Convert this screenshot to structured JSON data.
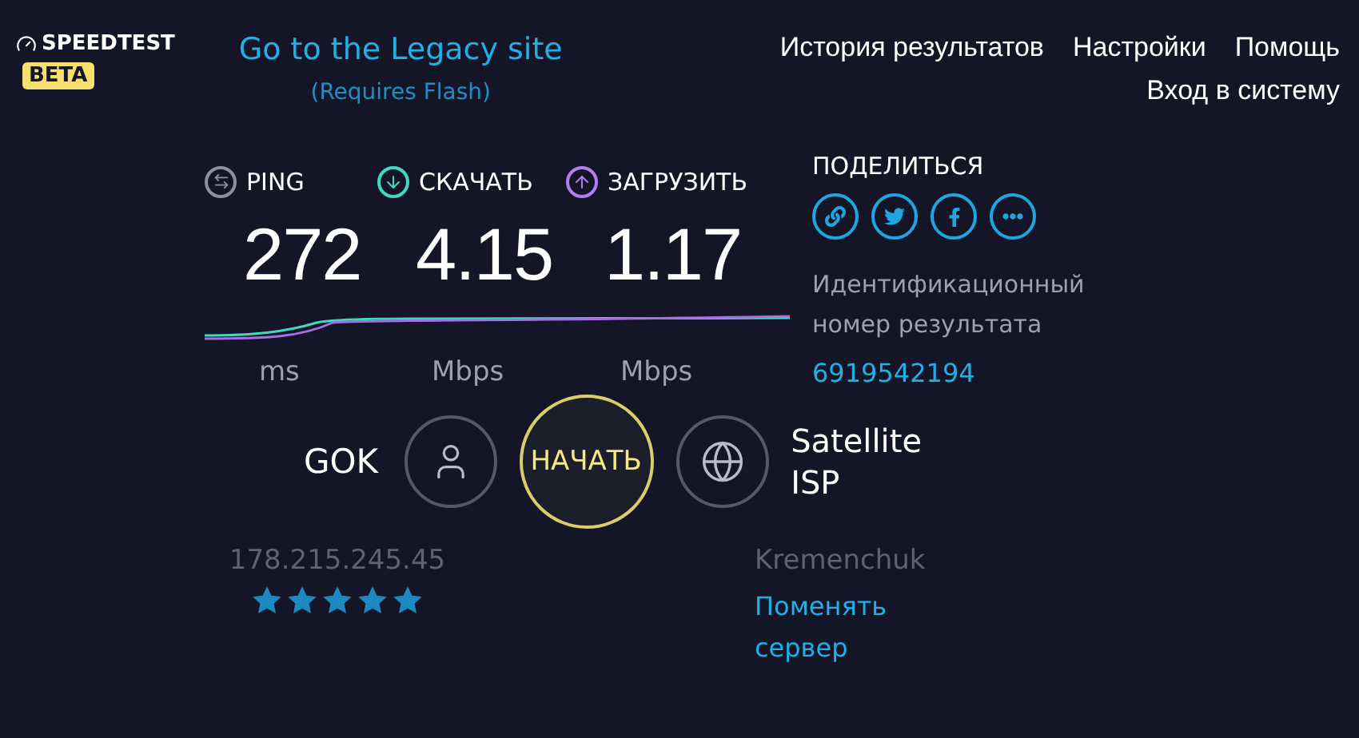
{
  "header": {
    "logo": "SPEEDTEST",
    "badge": "BETA",
    "legacy_link": "Go to the Legacy site",
    "legacy_note": "(Requires Flash)",
    "nav": [
      "История результатов",
      "Настройки",
      "Помощь"
    ],
    "login": "Вход в систему"
  },
  "metrics": [
    {
      "kind": "ping",
      "label": "PING",
      "value": "272",
      "unit": "ms"
    },
    {
      "kind": "download",
      "label": "СКАЧАТЬ",
      "value": "4.15",
      "unit": "Mbps"
    },
    {
      "kind": "upload",
      "label": "ЗАГРУЗИТЬ",
      "value": "1.17",
      "unit": "Mbps"
    }
  ],
  "share": {
    "title": "ПОДЕЛИТЬСЯ",
    "buttons": [
      {
        "kind": "link"
      },
      {
        "kind": "twitter"
      },
      {
        "kind": "facebook"
      },
      {
        "kind": "more"
      }
    ]
  },
  "result_id": {
    "label": "Идентификационный номер результата",
    "value": "6919542194"
  },
  "client": {
    "name": "GOK",
    "ip": "178.215.245.45",
    "stars": 5
  },
  "start_button": "НАЧАТЬ",
  "server": {
    "provider": "Satellite ISP",
    "location": "Kremenchuk",
    "change_link": "Поменять сервер"
  }
}
